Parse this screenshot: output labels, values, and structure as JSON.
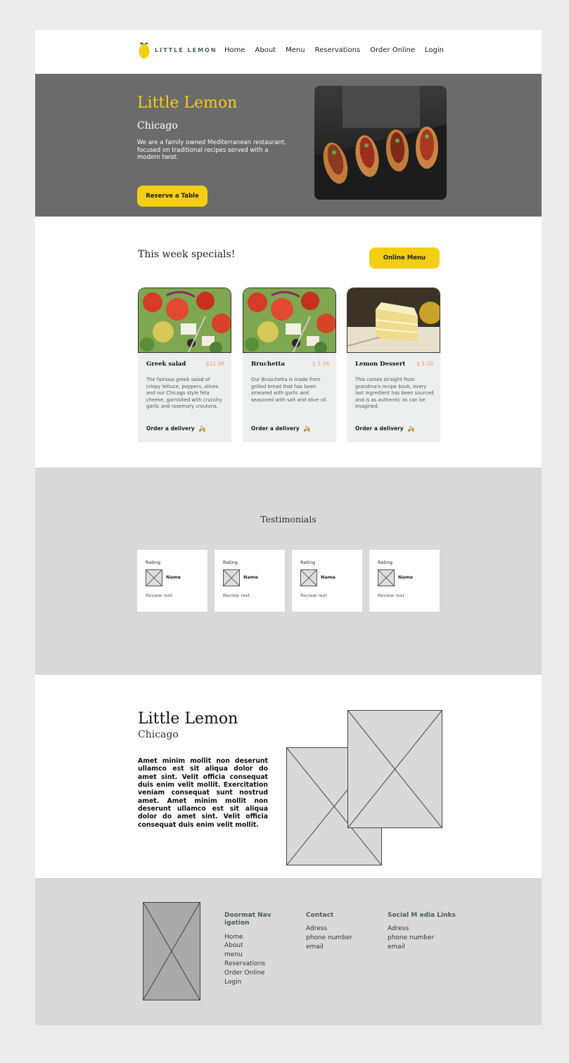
{
  "header": {
    "logo_text": "LITTLE LEMON",
    "nav": [
      "Home",
      "About",
      "Menu",
      "Reservations",
      "Order Online",
      "Login"
    ]
  },
  "hero": {
    "title": "Little Lemon",
    "city": "Chicago",
    "description": "We are a family owned Mediterranean restaurant, focused on traditional recipes served with a modern twist.",
    "button": "Reserve a Table"
  },
  "specials": {
    "title": "This week specials!",
    "button": "Online Menu",
    "items": [
      {
        "name": "Greek salad",
        "price": "$12.99",
        "description": "The famous greek salad of crispy lettuce, peppers, olives and our Chicago style feta cheese, garnished with crunchy garlic and rosemary croutons.",
        "order": "Order a delivery"
      },
      {
        "name": "Bruchetta",
        "price": "$ 5.99",
        "description": "Our Bruschetta is made from grilled bread that has been smeared with garlic and seasoned with salt and olive oil.",
        "order": "Order a delivery"
      },
      {
        "name": "Lemon Dessert",
        "price": "$ 5.00",
        "description": "This comes straight from grandma's recipe book, every last ingredient has been sourced and is as authentic as can be imagined.",
        "order": "Order a delivery"
      }
    ]
  },
  "testimonials": {
    "title": "Testimonials",
    "cards": [
      {
        "rating": "Rating",
        "name": "Name",
        "review": "Review rext"
      },
      {
        "rating": "Rating",
        "name": "Name",
        "review": "Review rext"
      },
      {
        "rating": "Rating",
        "name": "Name",
        "review": "Review rext"
      },
      {
        "rating": "Rating",
        "name": "Name",
        "review": "Review rext"
      }
    ]
  },
  "about": {
    "title": "Little Lemon",
    "city": "Chicago",
    "text": "Amet minim mollit non deserunt ullamco est sit aliqua dolor do amet sint. Velit officia consequat duis enim velit mollit. Exercitation veniam consequat sunt nostrud amet. Amet minim mollit non deserunt ullamco est sit aliqua dolor do amet sint. Velit officia consequat duis enim velit mollit."
  },
  "footer": {
    "nav_heading": "Doormat Nav igation",
    "nav_items": [
      "Home",
      "About",
      "menu",
      "Reservations",
      "Order Online",
      "Login"
    ],
    "contact_heading": "Contact",
    "contact_items": [
      "Adress",
      "phone number",
      "email"
    ],
    "social_heading": "Social M edia Links",
    "social_items": [
      "Adress",
      "phone number",
      "email"
    ]
  },
  "colors": {
    "brand_yellow": "#f4ce14",
    "hero_bg": "#6b6b6b",
    "price": "#ee9972",
    "dark_green": "#495e57"
  }
}
